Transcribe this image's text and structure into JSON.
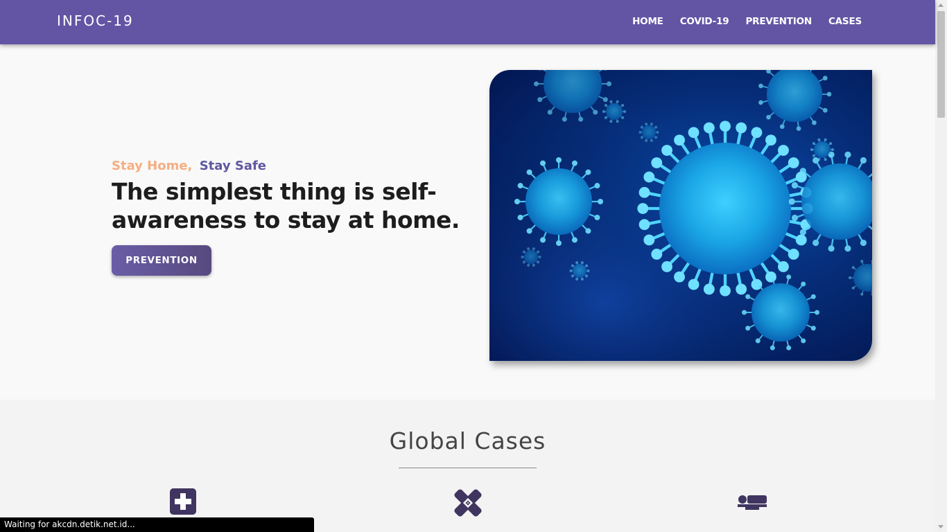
{
  "nav": {
    "brand": "INFOC-19",
    "links": [
      {
        "label": "HOME"
      },
      {
        "label": "COVID-19"
      },
      {
        "label": "PREVENTION"
      },
      {
        "label": "CASES"
      }
    ]
  },
  "hero": {
    "tagline_part1": "Stay Home,",
    "tagline_part2": "Stay Safe",
    "headline": "The simplest thing is self-awareness to stay at home.",
    "button_label": "PREVENTION"
  },
  "global_cases": {
    "title": "Global Cases",
    "icons": [
      "medical-cross-icon",
      "bandage-icon",
      "hospital-bed-icon"
    ]
  },
  "status_bar": {
    "text": "Waiting for akcdn.detik.net.id..."
  },
  "colors": {
    "navbar": "#6355a4",
    "tagline_accent": "#f6ae81",
    "tagline_primary": "#5f58a0",
    "icon_color": "#3f3560"
  }
}
